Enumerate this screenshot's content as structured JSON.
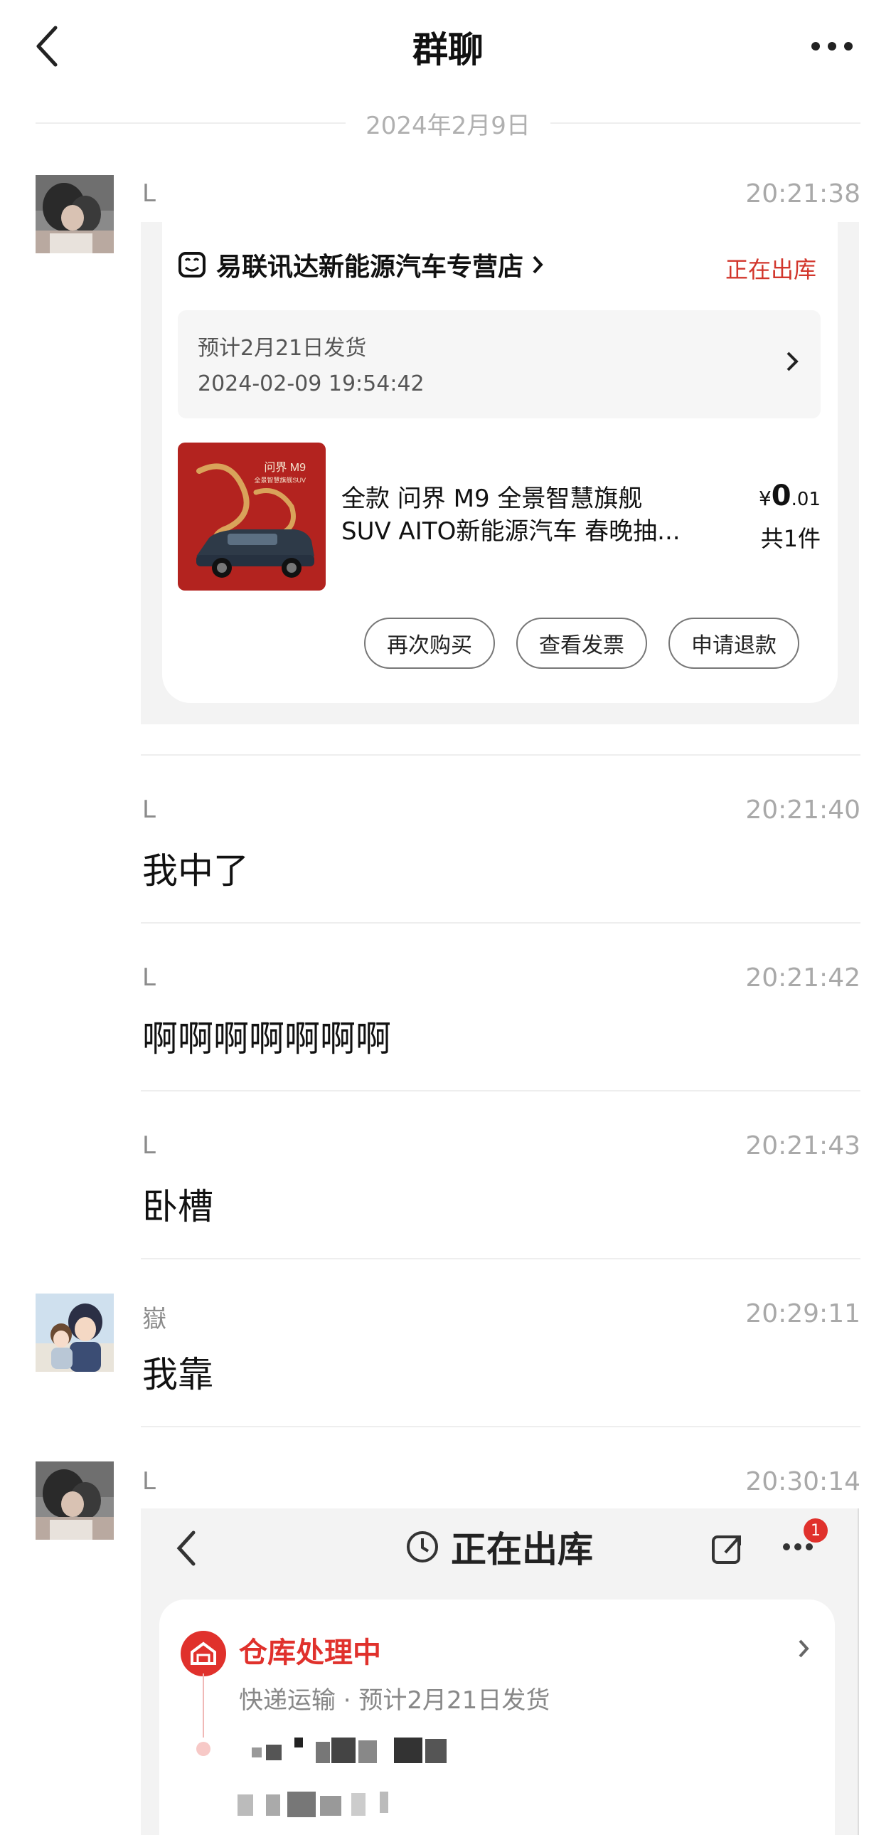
{
  "header": {
    "title": "群聊"
  },
  "date_separator": "2024年2月9日",
  "messages": [
    {
      "sender": "L",
      "time": "20:21:38"
    },
    {
      "sender": "L",
      "time": "20:21:40",
      "text": "我中了"
    },
    {
      "sender": "L",
      "time": "20:21:42",
      "text": "啊啊啊啊啊啊啊"
    },
    {
      "sender": "L",
      "time": "20:21:43",
      "text": "卧槽"
    },
    {
      "sender": "嶽",
      "time": "20:29:11",
      "text": "我靠"
    },
    {
      "sender": "L",
      "time": "20:30:14"
    }
  ],
  "order_card": {
    "store_name": "易联讯达新能源汽车专营店",
    "status": "正在出库",
    "ship_estimate": "预计2月21日发货",
    "order_time": "2024-02-09 19:54:42",
    "product_line1": "全款    问界 M9 全景智慧旗舰",
    "product_line2": "SUV  AITO新能源汽车 春晚抽...",
    "product_image_caption": "问界 M9",
    "product_image_subcaption": "全景智慧旗舰SUV",
    "price_currency": "¥",
    "price_int": "0",
    "price_dec": ".01",
    "quantity": "共1件",
    "buttons": [
      "再次购买",
      "查看发票",
      "申请退款"
    ]
  },
  "screenshot": {
    "title": "正在出库",
    "badge": "1",
    "warehouse_title": "仓库处理中",
    "warehouse_sub": "快递运输 · 预计2月21日发货"
  },
  "colors": {
    "accent_red": "#d2362c",
    "badge_red": "#e0312c"
  }
}
